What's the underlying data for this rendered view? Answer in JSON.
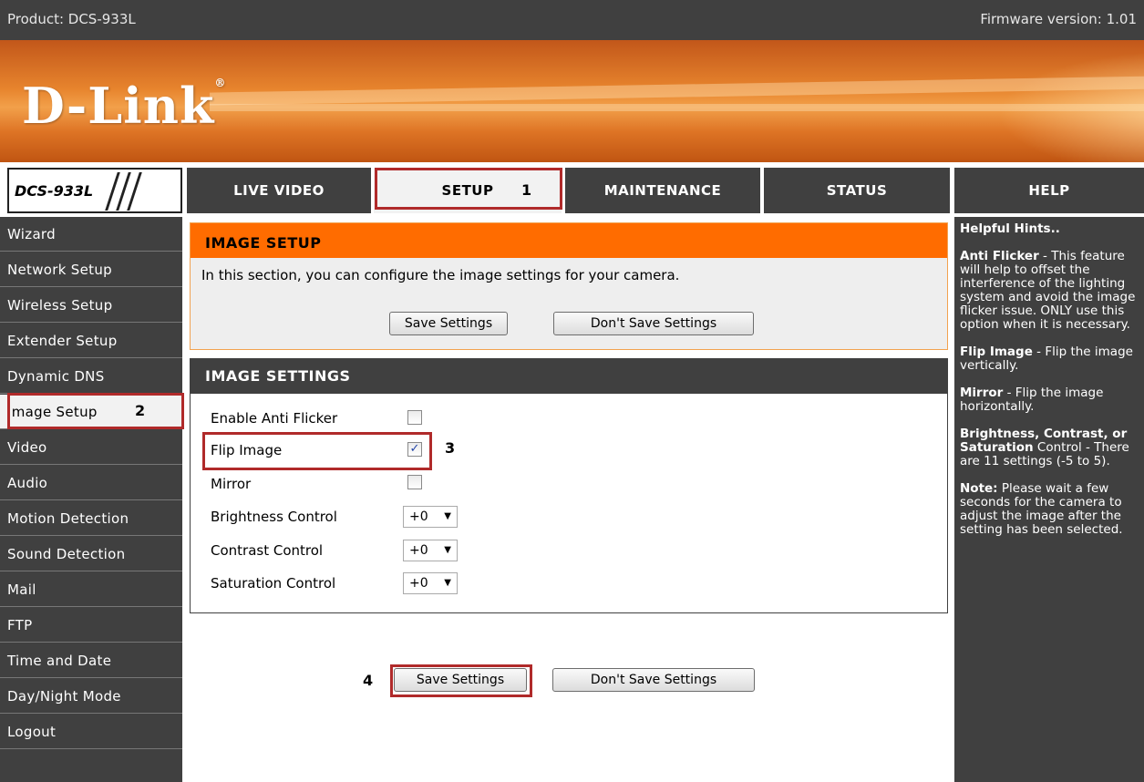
{
  "topbar": {
    "product": "Product: DCS-933L",
    "firmware": "Firmware version: 1.01"
  },
  "logo": {
    "text": "D-Link",
    "mark": "®"
  },
  "model_badge": "DCS-933L",
  "nav": {
    "tabs": [
      {
        "label": "LIVE VIDEO",
        "active": false
      },
      {
        "label": "SETUP",
        "active": true
      },
      {
        "label": "MAINTENANCE",
        "active": false
      },
      {
        "label": "STATUS",
        "active": false
      },
      {
        "label": "HELP",
        "active": false
      }
    ]
  },
  "steps": {
    "s1": "1",
    "s2": "2",
    "s3": "3",
    "s4": "4"
  },
  "sidebar": {
    "items": [
      {
        "label": "Wizard"
      },
      {
        "label": "Network Setup"
      },
      {
        "label": "Wireless Setup"
      },
      {
        "label": "Extender Setup"
      },
      {
        "label": "Dynamic DNS"
      },
      {
        "label": "Image Setup",
        "selected": true
      },
      {
        "label": "Video"
      },
      {
        "label": "Audio"
      },
      {
        "label": "Motion Detection"
      },
      {
        "label": "Sound Detection"
      },
      {
        "label": "Mail"
      },
      {
        "label": "FTP"
      },
      {
        "label": "Time and Date"
      },
      {
        "label": "Day/Night Mode"
      },
      {
        "label": "Logout"
      }
    ]
  },
  "image_setup": {
    "title": "IMAGE SETUP",
    "description": "In this section, you can configure the image settings for your camera.",
    "save_label": "Save Settings",
    "dont_save_label": "Don't Save Settings"
  },
  "image_settings": {
    "title": "IMAGE SETTINGS",
    "anti_flicker": {
      "label": "Enable Anti Flicker",
      "checked": false
    },
    "flip": {
      "label": "Flip Image",
      "checked": true
    },
    "mirror": {
      "label": "Mirror",
      "checked": false
    },
    "brightness": {
      "label": "Brightness Control",
      "value": "+0"
    },
    "contrast": {
      "label": "Contrast Control",
      "value": "+0"
    },
    "saturation": {
      "label": "Saturation Control",
      "value": "+0"
    }
  },
  "bottom_buttons": {
    "save_label": "Save Settings",
    "dont_save_label": "Don't Save Settings"
  },
  "hints": {
    "heading": "Helpful Hints..",
    "anti_flicker_title": "Anti Flicker",
    "anti_flicker_text": " - This feature will help to offset the interference of the lighting system and avoid the image flicker issue. ONLY use this option when it is necessary.",
    "flip_title": "Flip Image",
    "flip_text": " - Flip the image vertically.",
    "mirror_title": "Mirror",
    "mirror_text": " - Flip the image horizontally.",
    "bcs_title": "Brightness, Contrast, or Saturation",
    "bcs_text": " Control - There are 11 settings (-5 to 5).",
    "note_title": "Note:",
    "note_text": " Please wait a few seconds for the camera to adjust the image after the setting has been selected."
  },
  "colors": {
    "header_bg": "#404040",
    "accent": "#ff6c00",
    "highlight": "#b02a2a"
  }
}
